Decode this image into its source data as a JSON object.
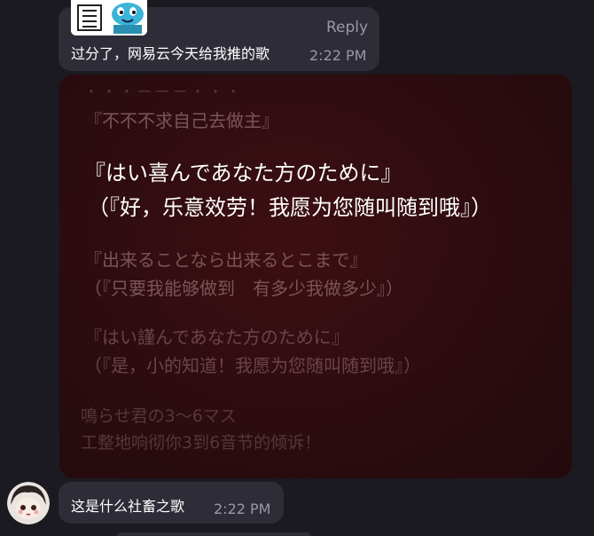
{
  "top_message": {
    "reply_label": "Reply",
    "text": "过分了，网易云今天给我推的歌",
    "time": "2:22 PM"
  },
  "image_card": {
    "dots": "・・・ーーー・・・",
    "title": "『不不不求自己去做主』",
    "highlight_ja": "『はい喜んであなた方のために』",
    "highlight_zh": "（『好，乐意效劳！我愿为您随叫随到哦』）",
    "line2_ja": "『出来ることなら出来るとこまで』",
    "line2_zh": "（『只要我能够做到　有多少我做多少』）",
    "line3_ja": "『はい謹んであなた方のために』",
    "line3_zh": "（『是，小的知道！我愿为您随叫随到哦』）",
    "line4_ja": "鳴らせ君の3〜6マス",
    "line4_zh": "工整地响彻你3到6音节的倾诉！"
  },
  "bottom_message": {
    "text": "这是什么社畜之歌",
    "time": "2:22 PM"
  },
  "colors": {
    "background": "#1b1a21",
    "bubble": "#2e2c37",
    "meta_text": "#9a97a6",
    "card_bg": "#2c0c10"
  }
}
